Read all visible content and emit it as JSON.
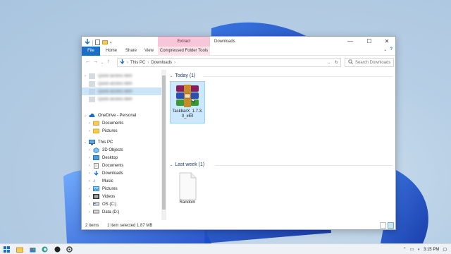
{
  "window": {
    "title": "Downloads",
    "context_tab": "Extract",
    "controls": {
      "minimize": "—",
      "maximize": "☐",
      "close": "✕"
    }
  },
  "ribbon": {
    "tabs": [
      "File",
      "Home",
      "Share",
      "View",
      "Compressed Folder Tools"
    ]
  },
  "address": {
    "path": [
      "This PC",
      "Downloads"
    ],
    "search_placeholder": "Search Downloads"
  },
  "nav": {
    "blurred": [
      "Quick access item",
      "Quick access item",
      "Quick access item",
      "Quick access item"
    ],
    "items": [
      {
        "label": "OneDrive - Personal",
        "level": 0,
        "icon": "cloud-icon",
        "expanded": true
      },
      {
        "label": "Documents",
        "level": 1,
        "icon": "folder-icon"
      },
      {
        "label": "Pictures",
        "level": 1,
        "icon": "folder-icon"
      },
      {
        "label": "This PC",
        "level": 0,
        "icon": "monitor-icon",
        "expanded": true
      },
      {
        "label": "3D Objects",
        "level": 1,
        "icon": "cube-icon"
      },
      {
        "label": "Desktop",
        "level": 1,
        "icon": "desktop-icon"
      },
      {
        "label": "Documents",
        "level": 1,
        "icon": "documents-icon"
      },
      {
        "label": "Downloads",
        "level": 1,
        "icon": "download-icon"
      },
      {
        "label": "Music",
        "level": 1,
        "icon": "music-icon"
      },
      {
        "label": "Pictures",
        "level": 1,
        "icon": "pictures-icon"
      },
      {
        "label": "Videos",
        "level": 1,
        "icon": "videos-icon"
      },
      {
        "label": "OS (C:)",
        "level": 1,
        "icon": "drive-icon"
      },
      {
        "label": "Data (D:)",
        "level": 1,
        "icon": "drive-icon"
      }
    ]
  },
  "content": {
    "groups": [
      {
        "header": "Today (1)",
        "file": "TaskbarX_1.7.3.0_x64",
        "icon": "winrar-archive-icon",
        "selected": true
      },
      {
        "header": "Last week (1)",
        "file": "Random",
        "icon": "blank-file-icon",
        "selected": false
      }
    ]
  },
  "status": {
    "items": "2 items",
    "selection": "1 item selected  1.87 MB"
  },
  "taskbar": {
    "time": "3:15 PM"
  },
  "colors": {
    "accent": "#1a6fc9",
    "context_tab": "#f7c6d8",
    "selection": "#cce8ff"
  }
}
